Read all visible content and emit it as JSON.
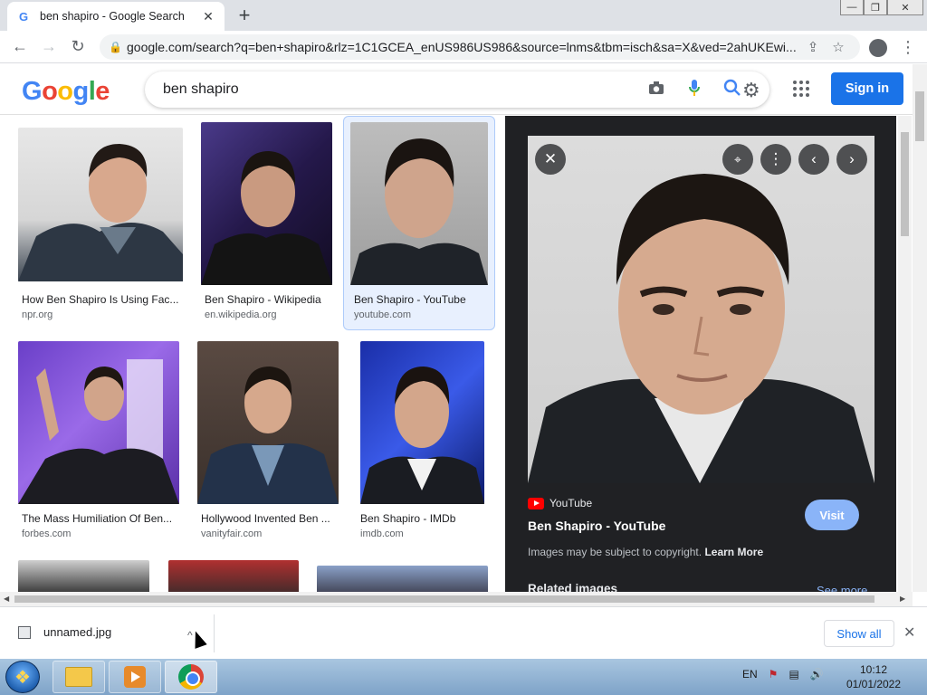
{
  "browser": {
    "tab_title": "ben shapiro - Google Search",
    "tab_favicon": "G",
    "url": "google.com/search?q=ben+shapiro&rlz=1C1GCEA_enUS986US986&source=lnms&tbm=isch&sa=X&ved=2ahUKEwi..."
  },
  "google": {
    "logo_letters": [
      "G",
      "o",
      "o",
      "g",
      "l",
      "e"
    ],
    "query": "ben shapiro",
    "signin_label": "Sign in"
  },
  "results": [
    {
      "caption": "How Ben Shapiro Is Using Fac...",
      "source": "npr.org"
    },
    {
      "caption": "Ben Shapiro - Wikipedia",
      "source": "en.wikipedia.org"
    },
    {
      "caption": "Ben Shapiro - YouTube",
      "source": "youtube.com"
    },
    {
      "caption": "The Mass Humiliation Of Ben...",
      "source": "forbes.com"
    },
    {
      "caption": "Hollywood Invented Ben ...",
      "source": "vanityfair.com"
    },
    {
      "caption": "Ben Shapiro - IMDb",
      "source": "imdb.com"
    }
  ],
  "preview": {
    "site_name": "YouTube",
    "title": "Ben Shapiro - YouTube",
    "visit_label": "Visit",
    "copyright_text": "Images may be subject to copyright.",
    "learn_more": "Learn More",
    "related_label": "Related images",
    "see_more": "See more"
  },
  "download": {
    "filename": "unnamed.jpg",
    "show_all_label": "Show all"
  },
  "taskbar": {
    "language": "EN",
    "time": "10:12",
    "date": "01/01/2022"
  },
  "colors": {
    "accent_blue": "#1a73e8",
    "panel_bg": "#202124",
    "visit_blue": "#8ab4f8",
    "youtube_red": "#ff0000"
  }
}
